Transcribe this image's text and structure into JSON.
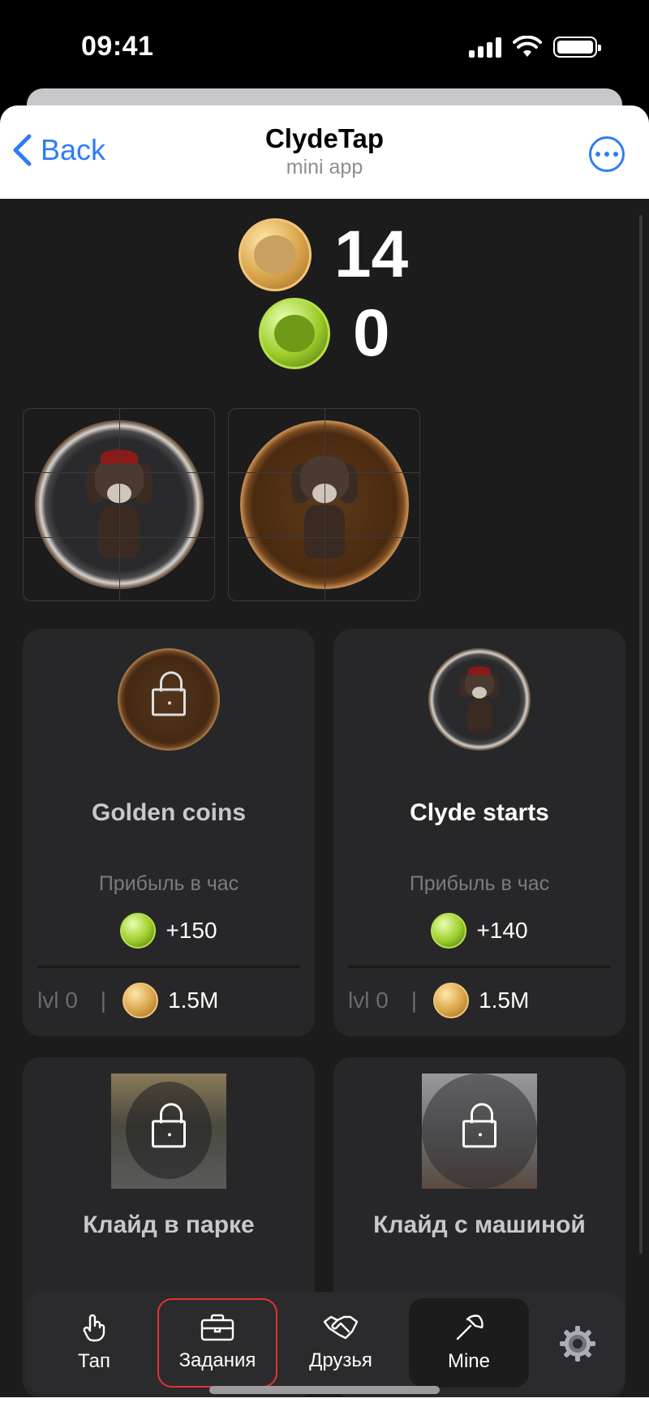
{
  "status_bar": {
    "time": "09:41"
  },
  "header": {
    "back_label": "Back",
    "title": "ClydeTap",
    "subtitle": "mini app"
  },
  "balances": {
    "gold": "14",
    "green": "0"
  },
  "cards": [
    {
      "title": "Golden coins",
      "profit_label": "Прибыль в час",
      "profit": "+150",
      "level": "lvl 0",
      "cost": "1.5M",
      "locked": true
    },
    {
      "title": "Clyde starts",
      "profit_label": "Прибыль в час",
      "profit": "+140",
      "level": "lvl 0",
      "cost": "1.5M",
      "locked": false
    },
    {
      "title": "Клайд в парке",
      "locked": true
    },
    {
      "title": "Клайд с машиной",
      "locked": true
    }
  ],
  "nav": {
    "tap": "Тап",
    "tasks": "Задания",
    "friends": "Друзья",
    "mine": "Mine"
  },
  "colors": {
    "accent": "#2f7cf6",
    "background": "#1c1c1d",
    "card": "#272729",
    "highlight_border": "#e8322c"
  }
}
